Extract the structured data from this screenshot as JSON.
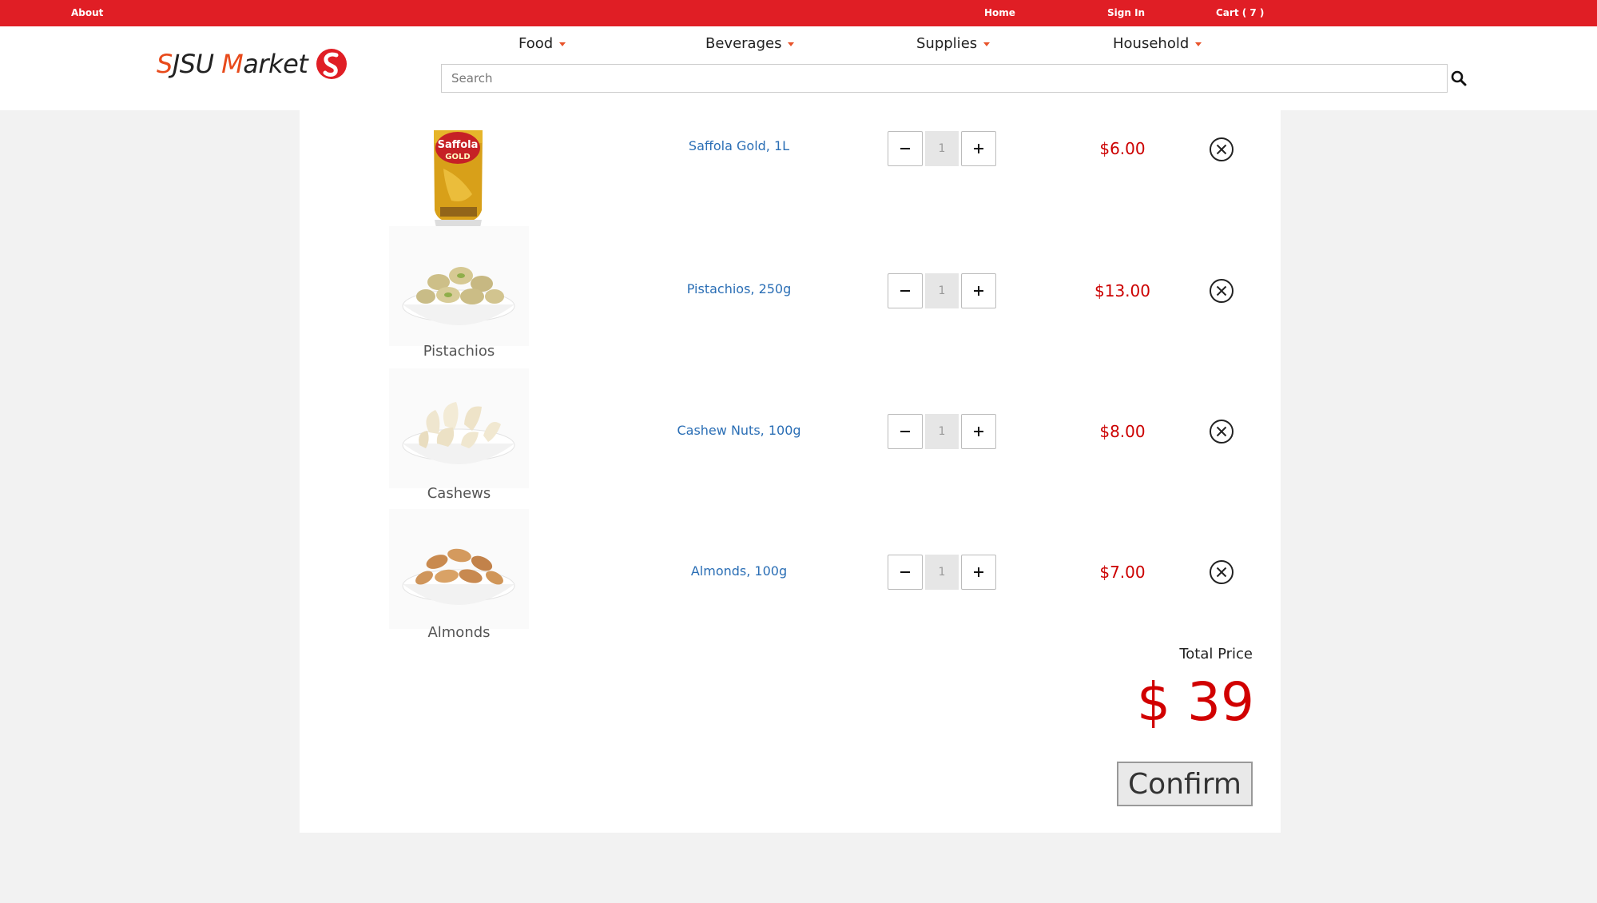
{
  "topbar": {
    "about": "About",
    "home": "Home",
    "sign_in": "Sign In",
    "cart": "Cart ( 7 )",
    "color": "#e01e25"
  },
  "brand": {
    "part1_initial": "S",
    "part1_rest": "JSU ",
    "part2_initial": "M",
    "part2_rest": "arket",
    "logo_icon": "safeway-s-icon"
  },
  "nav": {
    "items": [
      {
        "label": "Food"
      },
      {
        "label": "Beverages"
      },
      {
        "label": "Supplies"
      },
      {
        "label": "Household"
      }
    ]
  },
  "search": {
    "placeholder": "Search",
    "icon": "search-icon"
  },
  "cart": {
    "items": [
      {
        "name": "Saffola Gold, 1L",
        "image_caption": "",
        "quantity": "1",
        "price": "$6.00"
      },
      {
        "name": "Pistachios, 250g",
        "image_caption": "Pistachios",
        "quantity": "1",
        "price": "$13.00"
      },
      {
        "name": "Cashew Nuts, 100g",
        "image_caption": "Cashews",
        "quantity": "1",
        "price": "$8.00"
      },
      {
        "name": "Almonds, 100g",
        "image_caption": "Almonds",
        "quantity": "1",
        "price": "$7.00"
      }
    ],
    "total_label": "Total Price",
    "total_value": "$ 39",
    "confirm_label": "Confirm",
    "price_color": "#cc0000",
    "link_color": "#2a6eb5"
  }
}
